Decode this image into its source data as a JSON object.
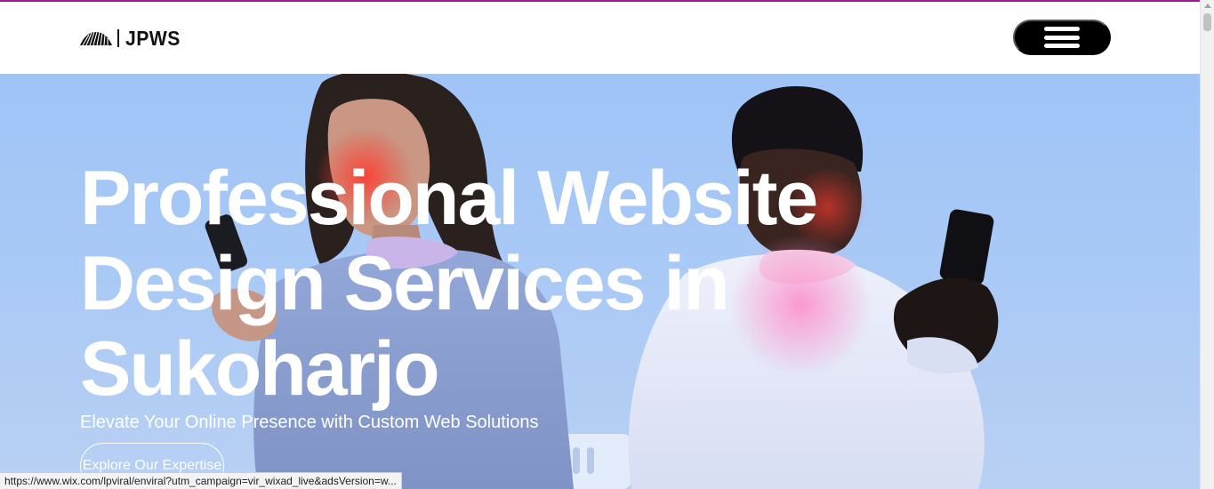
{
  "brand": {
    "name": "JPWS",
    "accent_color": "#a21a8f",
    "logo_icon": "striped-fan-logo"
  },
  "header": {
    "menu_icon": "hamburger-menu-icon",
    "menu_button_color": "#000000"
  },
  "hero": {
    "headline": "Professional Website Design Services in Sukoharjo",
    "subheadline": "Elevate Your Online Presence with Custom Web Solutions",
    "cta_label": "Explore Our Expertise",
    "background_color": "#a9c9f6"
  },
  "status_bar": {
    "url": "https://www.wix.com/lpviral/enviral?utm_campaign=vir_wixad_live&adsVersion=w..."
  }
}
